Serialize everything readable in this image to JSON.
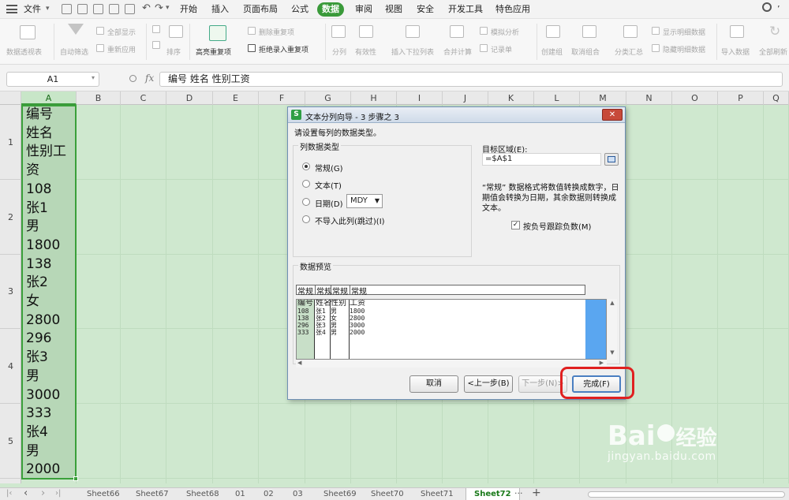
{
  "menubar": {
    "file": "文件",
    "tabs": [
      "开始",
      "插入",
      "页面布局",
      "公式",
      "数据",
      "审阅",
      "视图",
      "安全",
      "开发工具",
      "特色应用"
    ],
    "active_tab": "数据",
    "right_text": "’"
  },
  "ribbon": {
    "pivot": "数据透视表",
    "autofilter": "自动筛选",
    "showall": "全部显示",
    "reapply": "重新应用",
    "sort": "排序",
    "highlight_dup": "高亮重复项",
    "delete_dup": "删除重复项",
    "reject_dup": "拒绝录入重复项",
    "split": "分列",
    "validity": "有效性",
    "insert_dropdown": "插入下拉列表",
    "merge_calc": "合并计算",
    "simulate": "模拟分析",
    "record": "记录单",
    "create_group": "创建组",
    "ungroup": "取消组合",
    "subtotal": "分类汇总",
    "show_detail": "显示明细数据",
    "hide_detail": "隐藏明细数据",
    "import": "导入数据",
    "refresh_all": "全部刷新"
  },
  "formula_bar": {
    "name_box": "A1",
    "fx": "fx",
    "content": "编号  姓名  性别工资"
  },
  "grid": {
    "columns": [
      "A",
      "B",
      "C",
      "D",
      "E",
      "F",
      "G",
      "H",
      "I",
      "J",
      "K",
      "L",
      "M",
      "N",
      "O",
      "P",
      "Q"
    ],
    "rows": [
      "1",
      "2",
      "3",
      "4",
      "5"
    ],
    "cell_a_lines": [
      [
        "编号",
        "姓名",
        "性别工",
        "资"
      ],
      [
        "108",
        "张1",
        "男",
        "1800"
      ],
      [
        "138",
        "张2",
        "女",
        "2800"
      ],
      [
        "296",
        "张3",
        "男",
        "3000"
      ],
      [
        "333",
        "张4",
        "男",
        "2000"
      ]
    ]
  },
  "sheet_tabs": {
    "tabs": [
      "Sheet66",
      "Sheet67",
      "Sheet68",
      "01",
      "02",
      "03",
      "Sheet69",
      "Sheet70",
      "Sheet71",
      "Sheet72"
    ],
    "active": "Sheet72",
    "more": "···",
    "add": "+"
  },
  "dialog": {
    "title": "文本分列向导 - 3 步骤之 3",
    "instruction": "请设置每列的数据类型。",
    "col_type_label": "列数据类型",
    "options": [
      "常规(G)",
      "文本(T)",
      "日期(D)",
      "不导入此列(跳过)(I)"
    ],
    "selected_option": "常规(G)",
    "date_format": "MDY",
    "target_label": "目标区域(E):",
    "target_value": "=$A$1",
    "note": "“常规” 数据格式将数值转换成数字，日期值会转换为日期，其余数据则转换成文本。",
    "negative_label": "按负号跟踪负数(M)",
    "negative_checked": true,
    "preview_label": "数据预览",
    "preview_headers": [
      "常规",
      "常规",
      "常规",
      "常规"
    ],
    "preview_rows": [
      [
        "编号",
        "姓名",
        "性别",
        "工资"
      ],
      [
        "108",
        "张1",
        "男",
        "1800"
      ],
      [
        "138",
        "张2",
        "女",
        "2800"
      ],
      [
        "296",
        "张3",
        "男",
        "3000"
      ],
      [
        "333",
        "张4",
        "男",
        "2000"
      ]
    ],
    "btn_cancel": "取消",
    "btn_prev": "<上一步(B)",
    "btn_next": "下一步(N)>",
    "btn_finish": "完成(F)"
  },
  "colors": {
    "accent": "#3a9a3a",
    "highlight": "#e02020",
    "sheet_bg": "#cfe8cf"
  },
  "watermark": "Bai 经验 jingyan.baidu.com"
}
